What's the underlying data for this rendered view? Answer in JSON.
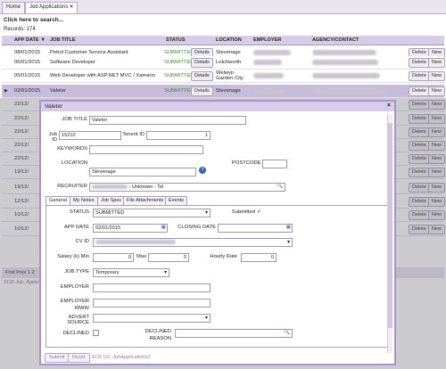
{
  "tabs": [
    {
      "label": "Home"
    },
    {
      "label": "Job Applications"
    }
  ],
  "tab_close": "×",
  "search_text": "Click here to search...",
  "records": "Records: 174",
  "columns": [
    "APP DATE",
    "JOB TITLE",
    "STATUS",
    "LOCATION",
    "EMPLOYER",
    "AGENCY/CONTACT"
  ],
  "sort_indicator": "▼",
  "rows": [
    {
      "date": "08/01/2015",
      "title": "Petrol Customer Service Assistant",
      "status": "SUBMITTED",
      "location": "Stevenage"
    },
    {
      "date": "06/01/2015",
      "title": "Software Developer",
      "status": "SUBMITTED",
      "location": "Letchworth"
    },
    {
      "date": "05/01/2015",
      "title": "Web Developer with ASP.NET MVC / Xamarin",
      "status": "SUBMITTED",
      "location": "Welwyn Garden City"
    },
    {
      "date": "02/01/2015",
      "title": "Valeter",
      "status": "SUBMITTED",
      "location": "Stevenage"
    },
    {
      "date": "22/12/",
      "title": "",
      "status": "",
      "location": ""
    },
    {
      "date": "22/12/",
      "title": "",
      "status": "",
      "location": ""
    },
    {
      "date": "22/12/",
      "title": "",
      "status": "",
      "location": ""
    },
    {
      "date": "22/12/",
      "title": "",
      "status": "",
      "location": ""
    },
    {
      "date": "22/12/",
      "title": "",
      "status": "",
      "location": ""
    },
    {
      "date": "19/12/",
      "title": "",
      "status": "",
      "location": ""
    },
    {
      "date": "19/12/",
      "title": "",
      "status": "",
      "location": ""
    },
    {
      "date": "12/12/",
      "title": "",
      "status": "",
      "location": ""
    },
    {
      "date": "10/12/",
      "title": "",
      "status": "",
      "location": ""
    },
    {
      "date": "10/12/",
      "title": "",
      "status": "",
      "location": ""
    }
  ],
  "row_buttons": {
    "details": "Details",
    "delete": "Delete",
    "new": "New"
  },
  "selected_marker": "▶",
  "pager": "First Prev 1 2",
  "grid_path": "SCR Job_Applica",
  "dialog": {
    "title": "Valeter",
    "close": "×",
    "job_title_label": "JOB TITLE",
    "job_title": "Valeter",
    "job_id_label": "Job ID",
    "job_id": "15210",
    "tenant_id_label": "Tenent ID",
    "tenant_id": "1",
    "keywords_label": "KEYWORDS",
    "location_label": "LOCATION",
    "location": "Stevenage",
    "postcode_label": "POSTCODE",
    "help_icon": "?",
    "recruiter_label": "RECRUITER",
    "recruiter": "- Unknown - Tel",
    "search_icon": "🔍",
    "tabs": [
      "General",
      "My Notes",
      "Job Spec",
      "File Attachments",
      "Events"
    ],
    "status_label": "STATUS",
    "status": "SUBMITTED",
    "submitted_label": "Submitted",
    "submitted_check": "✓",
    "app_date_label": "APP DATE",
    "app_date": "02/01/2015",
    "closing_date_label": "CLOSING DATE",
    "calendar_icon": "▦",
    "cv_id_label": "CV ID",
    "salary_min_label": "Salary (k) Min",
    "salary_min": "0",
    "max_label": "Max",
    "salary_max": "0",
    "hourly_rate_label": "Hourly Rate",
    "hourly_rate": "0",
    "job_type_label": "JOB TYPE",
    "job_type": "Temporary",
    "employer_label": "EMPLOYER",
    "employer_www_label": "EMPLOYER WWW",
    "advert_source_label": "ADVERT SOURCE",
    "declined_label": "DECLINED",
    "declined_reason_label": "DECLINED REASON",
    "submit": "Submit",
    "reset": "Reset",
    "path": "SCR UX_JobApplications2"
  },
  "colors": {
    "accent": "#a994c9",
    "header": "#d7cde6",
    "status_green": "#3c8a2e"
  }
}
